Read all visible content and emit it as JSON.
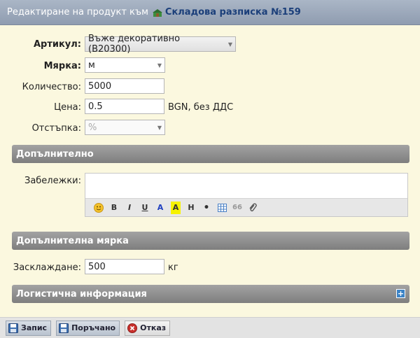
{
  "window": {
    "title_prefix": "Редактиране на продукт към",
    "document_link": "Складова разписка №159"
  },
  "form": {
    "article": {
      "label": "Артикул:",
      "value": "Въже декоративно (B20300)"
    },
    "unit": {
      "label": "Мярка:",
      "value": "м"
    },
    "quantity": {
      "label": "Количество:",
      "value": "5000"
    },
    "price": {
      "label": "Цена:",
      "value": "0.5",
      "suffix": "BGN, без ДДС"
    },
    "discount": {
      "label": "Отстъпка:",
      "placeholder": "%"
    }
  },
  "sections": {
    "additional": {
      "title": "Допълнително"
    },
    "notes": {
      "label": "Забележки:",
      "value": ""
    },
    "extra_unit": {
      "title": "Допълнителна мярка"
    },
    "packing": {
      "label": "Засклаждане:",
      "value": "500",
      "suffix": "кг"
    },
    "logistics": {
      "title": "Логистична информация",
      "expand_icon": "+"
    }
  },
  "editor_toolbar": {
    "bold": "B",
    "italic": "I",
    "underline": "U",
    "color": "A",
    "highlight": "A",
    "heading": "H",
    "bullet": "•",
    "quote": "66"
  },
  "footer": {
    "save": "Запис",
    "ordered": "Поръчано",
    "cancel": "Отказ"
  },
  "colors": {
    "background": "#fbf8df",
    "section_header": "#8f8f8f",
    "title_link": "#1b3f7a",
    "expand_icon": "#3b83c6",
    "cancel_icon": "#c9302c"
  }
}
